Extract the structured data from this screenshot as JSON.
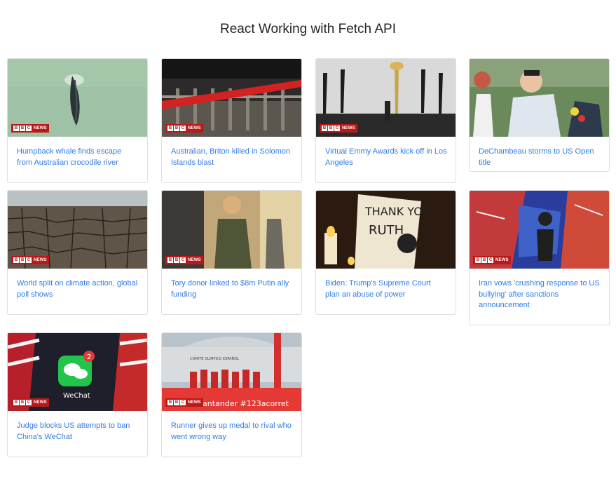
{
  "page": {
    "title": "React Working with Fetch API"
  },
  "badge": {
    "b1": "B",
    "b2": "B",
    "b3": "C",
    "news": "NEWS"
  },
  "articles": [
    {
      "title": "Humpback whale finds escape from Australian crocodile river"
    },
    {
      "title": "Australian, Briton killed in Solomon Islands blast"
    },
    {
      "title": "Virtual Emmy Awards kick off in Los Angeles"
    },
    {
      "title": "DeChambeau storms to US Open title"
    },
    {
      "title": "World split on climate action, global poll shows"
    },
    {
      "title": "Tory donor linked to $8m Putin ally funding"
    },
    {
      "title": "Biden: Trump's Supreme Court plan an abuse of power"
    },
    {
      "title": "Iran vows 'crushing response to US bullying' after sanctions announcement"
    },
    {
      "title": "Judge blocks US attempts to ban China's WeChat"
    },
    {
      "title": "Runner gives up medal to rival who went wrong way"
    }
  ],
  "images": {
    "wechat_badge": "2",
    "wechat_label": "WeChat",
    "runner_banner": "antander   #123acorret",
    "runner_building": "COMITE OLIMPICO ESPAÑOL"
  },
  "colors": {
    "link": "#2f7ce8",
    "bbc_red": "#bb1919"
  }
}
